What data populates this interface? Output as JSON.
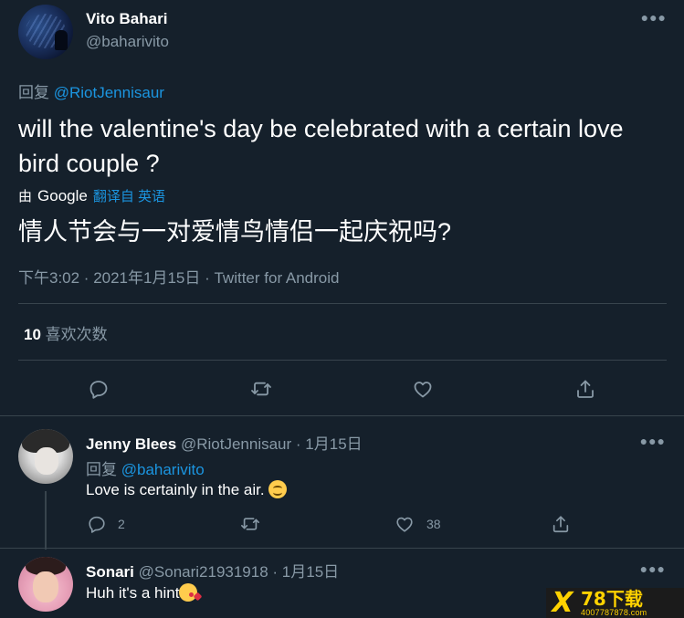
{
  "tweet": {
    "author_name": "Vito Bahari",
    "author_handle": "@baharivito",
    "replying_label": "回复",
    "replying_to": "@RiotJennisaur",
    "text": "will the valentine's day be celebrated with a certain love bird couple ?",
    "translated_by": "由",
    "translated_by_brand": "Google",
    "translated_from": "翻译自 英语",
    "translated_text": "情人节会与一对爱情鸟情侣一起庆祝吗?",
    "meta": "下午3:02 · 2021年1月15日 · Twitter for Android",
    "likes_count": "10",
    "likes_label": "喜欢次数"
  },
  "replies": [
    {
      "name": "Jenny Blees",
      "handle": "@RiotJennisaur",
      "date": "· 1月15日",
      "replying_label": "回复",
      "replying_to": "@baharivito",
      "text": "Love is certainly in the air.",
      "reply_count": "2",
      "like_count": "38"
    },
    {
      "name": "Sonari",
      "handle": "@Sonari21931918",
      "date": "· 1月15日",
      "text": "Huh it's a hint"
    }
  ],
  "watermark": {
    "logo_letter": "X",
    "main": "78下载",
    "sub": "4007787878.com"
  },
  "colors": {
    "background": "#15202b",
    "link": "#1b95e0",
    "secondary_text": "#8899a6",
    "divider": "#38444d"
  }
}
